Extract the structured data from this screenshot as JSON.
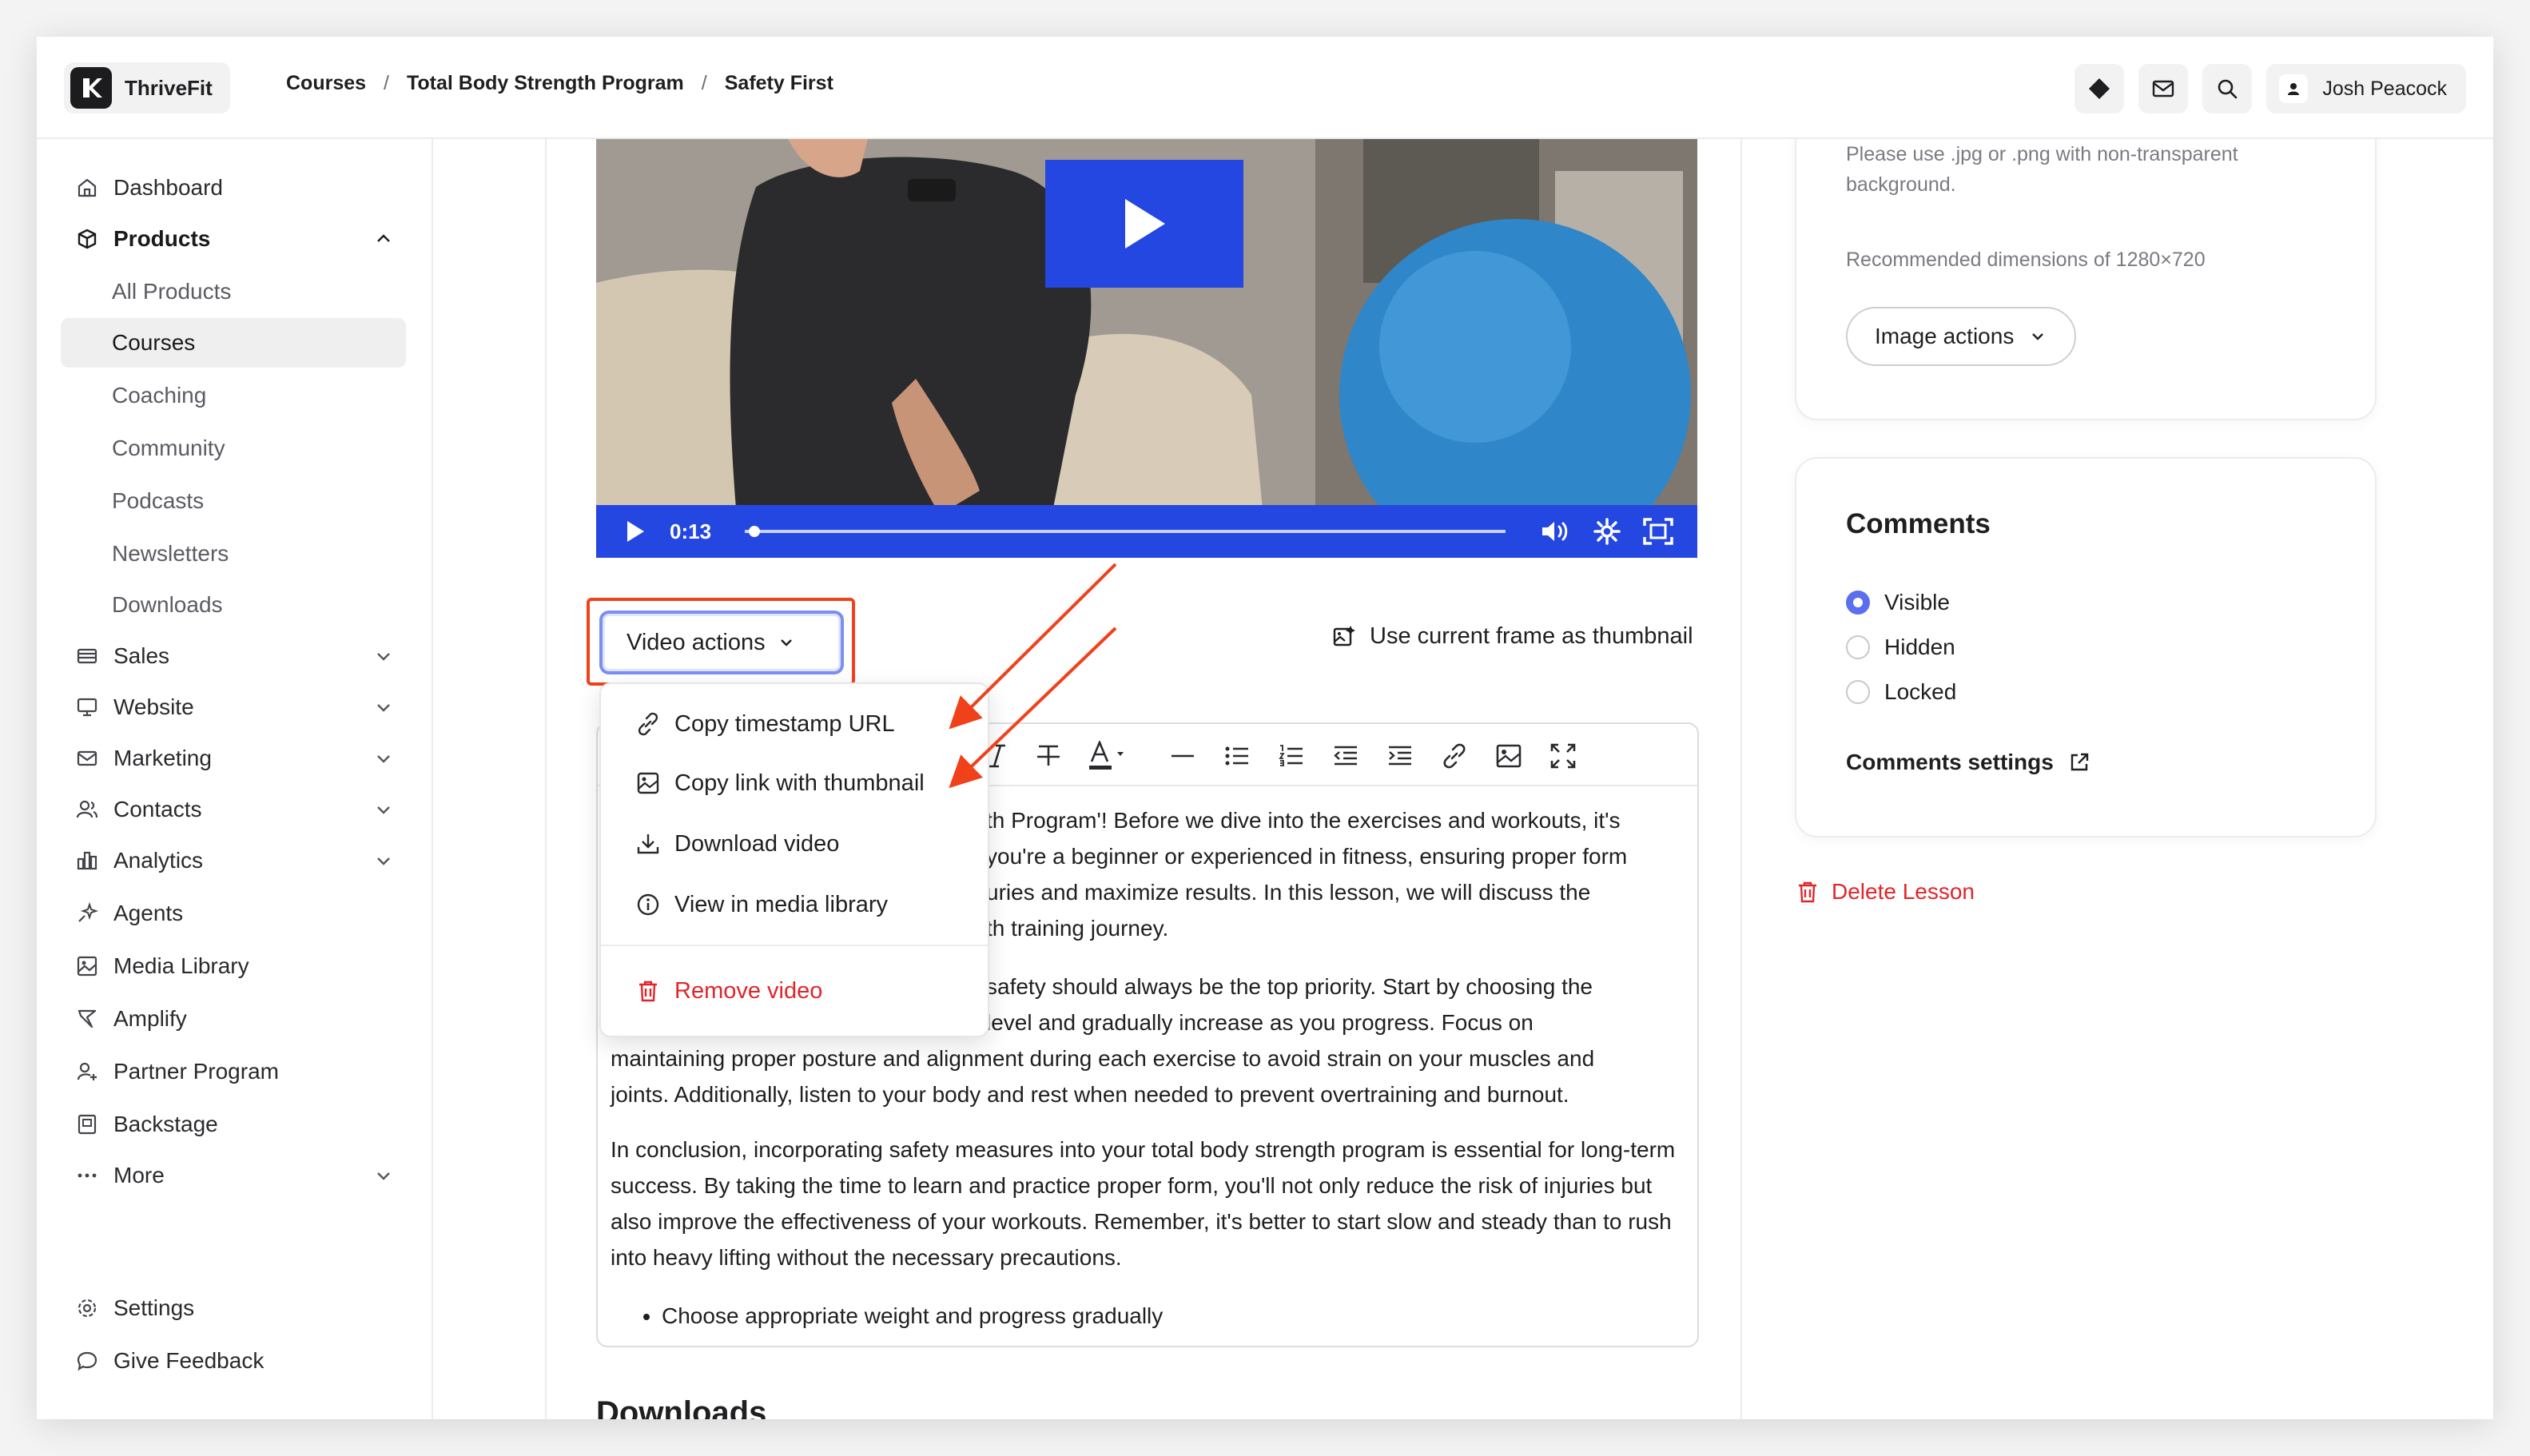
{
  "app": {
    "name": "ThriveFit"
  },
  "breadcrumb": [
    "Courses",
    "Total Body Strength Program",
    "Safety First"
  ],
  "header": {
    "user_name": "Josh Peacock"
  },
  "sidebar": {
    "items": [
      {
        "label": "Dashboard",
        "icon": "home-icon"
      },
      {
        "label": "Products",
        "icon": "box-icon",
        "expanded": true
      },
      {
        "label": "All Products"
      },
      {
        "label": "Courses",
        "active": true
      },
      {
        "label": "Coaching"
      },
      {
        "label": "Community"
      },
      {
        "label": "Podcasts"
      },
      {
        "label": "Newsletters"
      },
      {
        "label": "Downloads"
      },
      {
        "label": "Sales",
        "icon": "sales-icon"
      },
      {
        "label": "Website",
        "icon": "monitor-icon"
      },
      {
        "label": "Marketing",
        "icon": "mail-icon"
      },
      {
        "label": "Contacts",
        "icon": "users-icon"
      },
      {
        "label": "Analytics",
        "icon": "chart-icon"
      },
      {
        "label": "Agents",
        "icon": "sparkle-icon"
      },
      {
        "label": "Media Library",
        "icon": "image-icon"
      },
      {
        "label": "Amplify",
        "icon": "amplify-icon"
      },
      {
        "label": "Partner Program",
        "icon": "partner-icon"
      },
      {
        "label": "Backstage",
        "icon": "backstage-icon"
      },
      {
        "label": "More",
        "icon": "more-icon"
      }
    ],
    "footer": [
      {
        "label": "Settings",
        "icon": "gear-icon"
      },
      {
        "label": "Give Feedback",
        "icon": "feedback-icon"
      }
    ]
  },
  "video": {
    "current_time": "0:13",
    "progress_fraction": 0.005,
    "actions_label": "Video actions",
    "thumbnail_label": "Use current frame as thumbnail"
  },
  "video_menu": {
    "items": [
      {
        "label": "Copy timestamp URL",
        "icon": "link-icon"
      },
      {
        "label": "Copy link with thumbnail",
        "icon": "image-icon"
      },
      {
        "label": "Download video",
        "icon": "download-icon"
      },
      {
        "label": "View in media library",
        "icon": "info-icon"
      }
    ],
    "danger_item": {
      "label": "Remove video",
      "icon": "trash-icon"
    }
  },
  "editor": {
    "paragraphs": [
      {
        "prefix": "th Program'! Before we dive into the exercises and workouts, it's",
        "line2": "you're a beginner or experienced in fitness, ensuring proper form",
        "line3": "uries and maximize results. In this lesson, we will discuss the",
        "line4": "th training journey."
      },
      {
        "line1": "safety should always be the top priority. Start by choosing the",
        "line2": "level and gradually increase as you progress. Focus on",
        "line3": "maintaining proper posture and alignment during each exercise to avoid strain on your muscles and",
        "line4": "joints. Additionally, listen to your body and rest when needed to prevent overtraining and burnout."
      },
      {
        "text": "In conclusion, incorporating safety measures into your total body strength program is essential for long-term success. By taking the time to learn and practice proper form, you'll not only reduce the risk of injuries but also improve the effectiveness of your workouts. Remember, it's better to start slow and steady than to rush into heavy lifting without the necessary precautions."
      }
    ],
    "bullets": [
      "Choose appropriate weight and progress gradually"
    ]
  },
  "downloads_heading": "Downloads",
  "thumbnail_card": {
    "hint1": "Please use .jpg or .png with non-transparent background.",
    "hint2": "Recommended dimensions of 1280×720",
    "button": "Image actions"
  },
  "comments_card": {
    "title": "Comments",
    "options": [
      {
        "label": "Visible",
        "selected": true
      },
      {
        "label": "Hidden",
        "selected": false
      },
      {
        "label": "Locked",
        "selected": false
      }
    ],
    "settings_label": "Comments settings"
  },
  "delete_lesson_label": "Delete Lesson",
  "colors": {
    "accent": "#2347e0",
    "annotation": "#f0411b",
    "danger": "#e0252b",
    "radio": "#5b6ef0"
  }
}
